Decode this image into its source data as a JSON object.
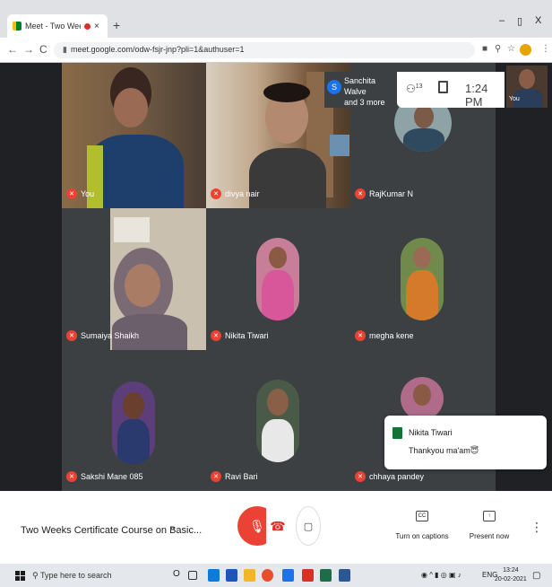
{
  "browser": {
    "tab_title": "Meet - Two Weeks Certificat",
    "tab_close": "×",
    "new_tab": "+",
    "window_minimize": "–",
    "window_restore": "▯",
    "window_close": "X",
    "back": "←",
    "forward": "→",
    "reload": "C",
    "url": "meet.google.com/odw-fsjr-jnp?pli=1&authuser=1"
  },
  "meet": {
    "presenter_avatar": "S",
    "presenter_line1": "Sanchita Walve",
    "presenter_line2": "and 3 more",
    "people_count": "13",
    "time": "1:24 PM",
    "self_label": "You",
    "tiles": [
      {
        "name": "You"
      },
      {
        "name": "divya nair"
      },
      {
        "name": "RajKumar N"
      },
      {
        "name": "Sumaiya Shaikh"
      },
      {
        "name": "Nikita Tiwari"
      },
      {
        "name": "megha kene"
      },
      {
        "name": "Sakshi Mane 085"
      },
      {
        "name": "Ravi Bari"
      },
      {
        "name": "chhaya pandey"
      }
    ],
    "chat": {
      "from": "Nikita Tiwari",
      "message": "Thankyou ma'am😇"
    }
  },
  "controls": {
    "meeting_title": "Two Weeks Certificate Course on Basic...",
    "caret": "^",
    "captions_label": "Turn on captions",
    "captions_icon": "CC",
    "present_label": "Present now",
    "kebab": "⋮"
  },
  "taskbar": {
    "search_placeholder": "Type here to search",
    "lang": "ENG",
    "time": "13:24",
    "date": "20-02-2021"
  },
  "colors": {
    "stage_bg": "#202124",
    "mic_off": "#ea4335",
    "accent_green": "#137333"
  }
}
